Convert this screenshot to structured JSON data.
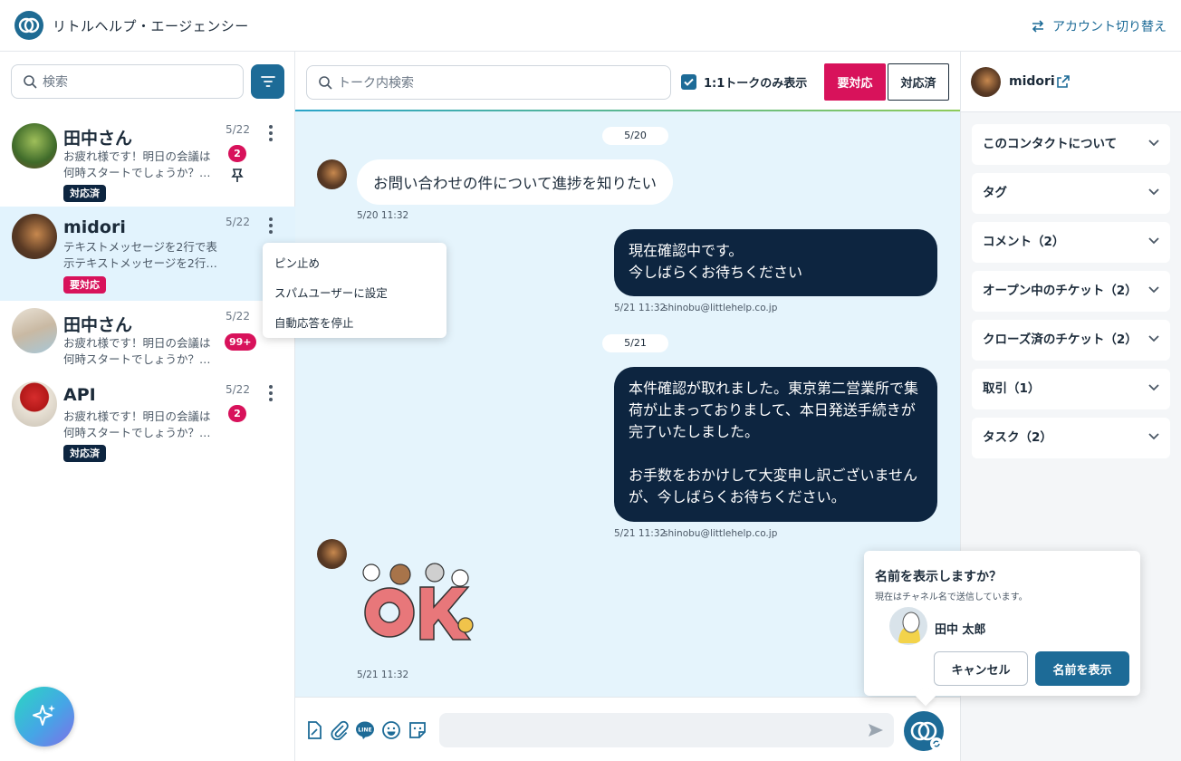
{
  "app": {
    "title": "リトルヘルプ・エージェンシー",
    "switch_account": "アカウント切り替え"
  },
  "sidebar": {
    "search_placeholder": "検索",
    "conversations": [
      {
        "name": "田中さん",
        "preview": "お疲れ様です！明日の会議は何時スタートでしょうか？…",
        "date": "5/22",
        "badge": "2",
        "pinned": true,
        "status": "対応済"
      },
      {
        "name": "midori",
        "preview": "テキストメッセージを2行で表示テキストメッセージを2行…",
        "date": "5/22",
        "badge": "",
        "pinned": false,
        "status": "要対応"
      },
      {
        "name": "田中さん",
        "preview": "お疲れ様です！明日の会議は何時スタートでしょうか？…",
        "date": "5/22",
        "badge": "99+",
        "pinned": false,
        "status": ""
      },
      {
        "name": "API",
        "preview": "お疲れ様です！明日の会議は何時スタートでしょうか？…",
        "date": "5/22",
        "badge": "2",
        "pinned": false,
        "status": "対応済"
      }
    ]
  },
  "context_menu": {
    "items": [
      "ピン止め",
      "スパムユーザーに設定",
      "自動応答を停止"
    ]
  },
  "chat": {
    "search_placeholder": "トーク内検索",
    "one_to_one_label": "1:1トークのみ表示",
    "btn_need_action": "要対応",
    "btn_done": "対応済",
    "messages": [
      {
        "type": "date",
        "text": "5/20"
      },
      {
        "type": "in",
        "text": "お問い合わせの件について進捗を知りたい",
        "time": "5/20 11:32"
      },
      {
        "type": "out",
        "text": "現在確認中です。\n今しばらくお待ちください",
        "time": "5/21 11:32",
        "sender": "shinobu@littlehelp.co.jp"
      },
      {
        "type": "date",
        "text": "5/21"
      },
      {
        "type": "out",
        "text": "本件確認が取れました。東京第二営業所で集荷が止まっておりまして、本日発送手続きが完了いたしました。\n\nお手数をおかけして大変申し訳ございませんが、今しばらくお待ちください。",
        "time": "5/21 11:32",
        "sender": "shinobu@littlehelp.co.jp"
      },
      {
        "type": "sticker",
        "text": "OK",
        "time": "5/21 11:32"
      }
    ]
  },
  "popover": {
    "title": "名前を表示しますか？",
    "subtitle": "現在はチャネル名で送信しています。",
    "user_name": "田中 太郎",
    "cancel": "キャンセル",
    "confirm": "名前を表示"
  },
  "contact": {
    "name": "midori",
    "sections": [
      "このコンタクトについて",
      "タグ",
      "コメント（2）",
      "オープン中のチケット（2）",
      "クローズ済のチケット（2）",
      "取引（1）",
      "タスク（2）"
    ]
  },
  "colors": {
    "primary": "#1d6b97",
    "navy": "#0d2540",
    "alert": "#d8125b",
    "chat_bg": "#e5f4fc"
  }
}
